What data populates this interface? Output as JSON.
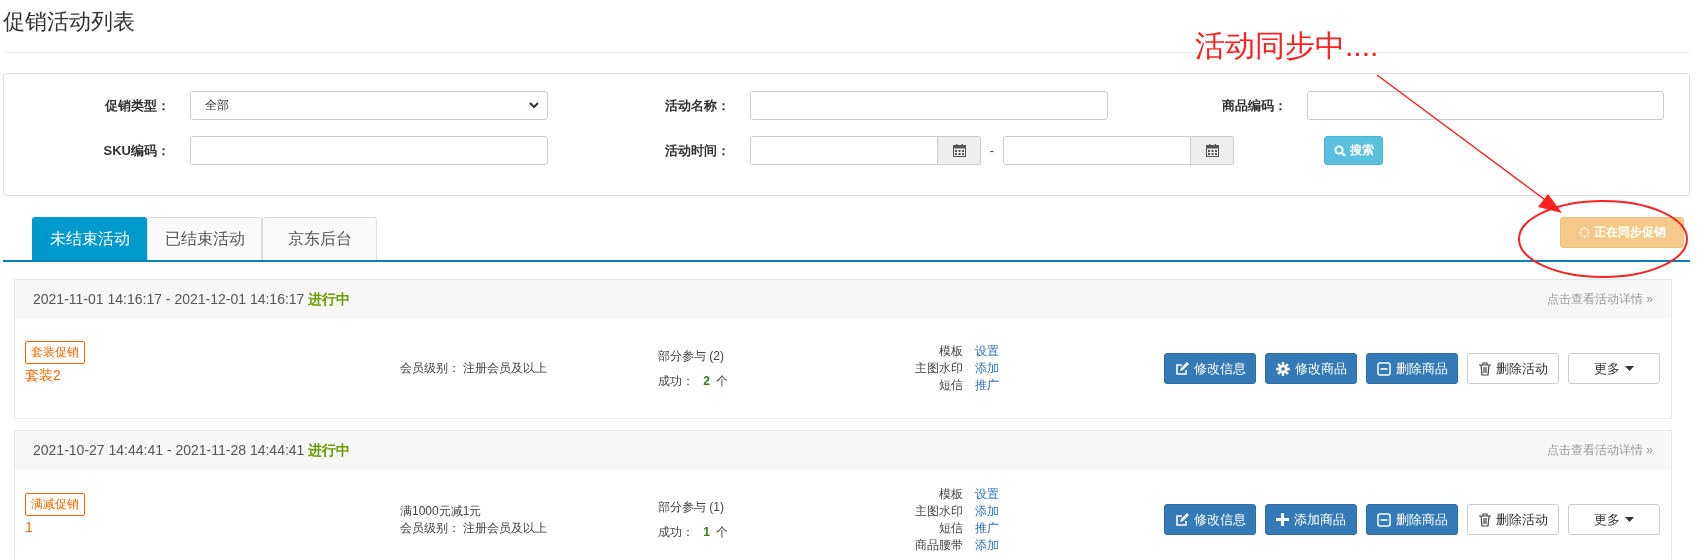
{
  "page_title": "促销活动列表",
  "annotation": {
    "text": "活动同步中...."
  },
  "filters": [
    {
      "label": "促销类型：",
      "kind": "select",
      "value": "全部"
    },
    {
      "label": "活动名称：",
      "kind": "text"
    },
    {
      "label": "商品编码：",
      "kind": "text"
    },
    {
      "label": "SKU编码：",
      "kind": "text"
    },
    {
      "label": "活动时间：",
      "kind": "daterange",
      "separator": "-"
    },
    {
      "kind": "button",
      "text": "搜索"
    }
  ],
  "tabs": [
    {
      "label": "未结束活动",
      "selected": true
    },
    {
      "label": "已结束活动",
      "selected": false
    },
    {
      "label": "京东后台",
      "selected": false
    }
  ],
  "sync_button": {
    "label": "正在同步促销"
  },
  "activities": [
    {
      "period": "2021-11-01 14:16:17 - 2021-12-01 14:16:17",
      "status": "进行中",
      "detail_link": "点击查看活动详情 »",
      "tag": "套装促销",
      "name": "套装2",
      "conditions": [
        "会员级别：  注册会员及以上"
      ],
      "participation": "部分参与 (2)",
      "success_label": "成功：",
      "success_count": "2",
      "success_unit": "个",
      "options": [
        {
          "label": "模板",
          "action": "设置"
        },
        {
          "label": "主图水印",
          "action": "添加"
        },
        {
          "label": "短信",
          "action": "推广"
        }
      ],
      "buttons": [
        {
          "label": "修改信息",
          "kind": "edit"
        },
        {
          "label": "修改商品",
          "kind": "gear"
        },
        {
          "label": "删除商品",
          "kind": "remove"
        },
        {
          "label": "删除活动",
          "kind": "delete"
        },
        {
          "label": "更多",
          "kind": "more"
        }
      ]
    },
    {
      "period": "2021-10-27 14:44:41 - 2021-11-28 14:44:41",
      "status": "进行中",
      "detail_link": "点击查看活动详情 »",
      "tag": "满减促销",
      "name": "1",
      "conditions": [
        "满1000元减1元",
        "会员级别：  注册会员及以上"
      ],
      "participation": "部分参与 (1)",
      "success_label": "成功：",
      "success_count": "1",
      "success_unit": "个",
      "options": [
        {
          "label": "模板",
          "action": "设置"
        },
        {
          "label": "主图水印",
          "action": "添加"
        },
        {
          "label": "短信",
          "action": "推广"
        },
        {
          "label": "商品腰带",
          "action": "添加"
        }
      ],
      "buttons": [
        {
          "label": "修改信息",
          "kind": "edit"
        },
        {
          "label": "添加商品",
          "kind": "add"
        },
        {
          "label": "删除商品",
          "kind": "remove"
        },
        {
          "label": "删除活动",
          "kind": "delete"
        },
        {
          "label": "更多",
          "kind": "more"
        }
      ]
    }
  ]
}
